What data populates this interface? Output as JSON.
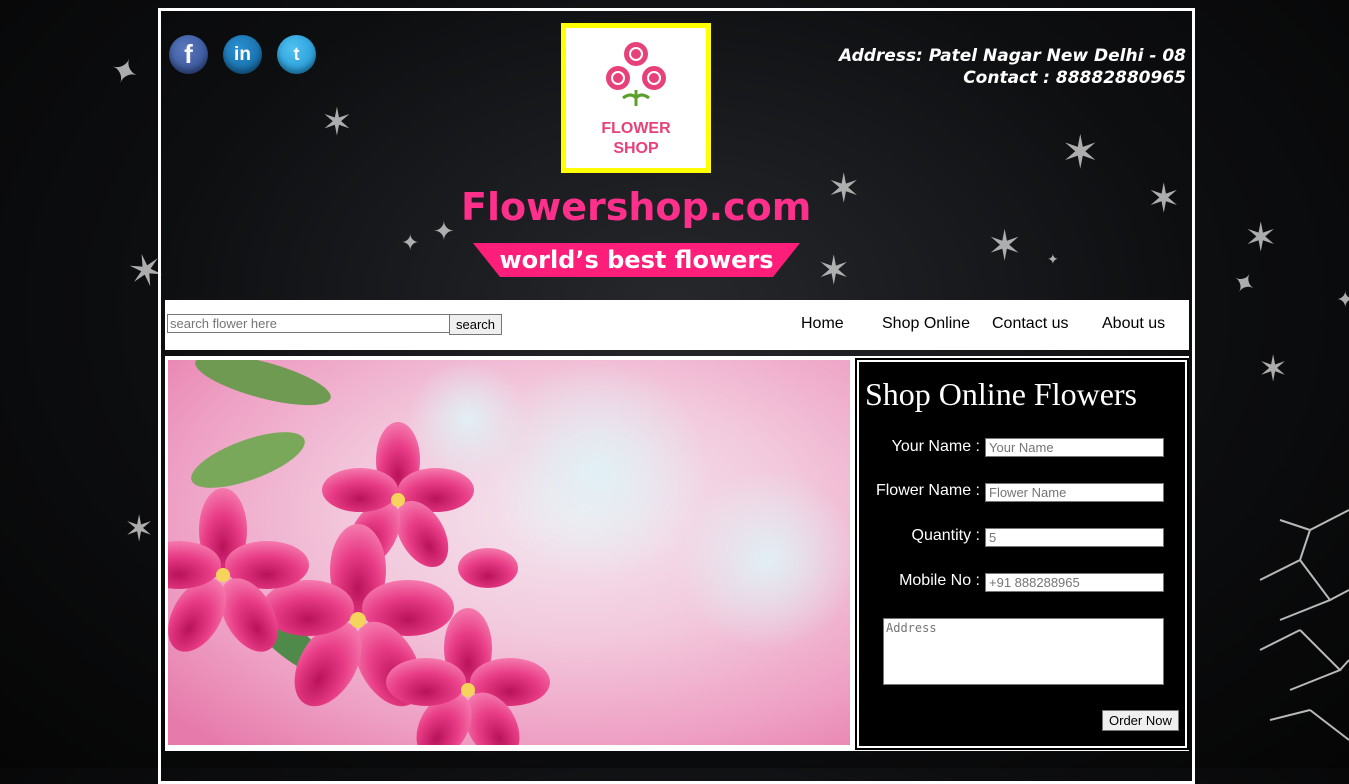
{
  "header": {
    "social": [
      {
        "name": "facebook",
        "glyph": "f"
      },
      {
        "name": "linkedin",
        "glyph": "in"
      },
      {
        "name": "twitter",
        "glyph": "t"
      }
    ],
    "logo": {
      "line1": "FLOWER",
      "line2": "SHOP"
    },
    "site_title": "Flowershop.com",
    "tagline": "world’s best flowers",
    "address": "Address: Patel Nagar New Delhi - 08",
    "contact": "Contact : 88882880965"
  },
  "navbar": {
    "search_placeholder": "search flower here",
    "search_button": "search",
    "links": [
      "Home",
      "Shop Online",
      "Contact us",
      "About us"
    ]
  },
  "order_form": {
    "title": "Shop Online Flowers",
    "fields": [
      {
        "label": "Your Name :",
        "placeholder": "Your Name"
      },
      {
        "label": "Flower Name :",
        "placeholder": "Flower Name"
      },
      {
        "label": "Quantity :",
        "placeholder": "5"
      },
      {
        "label": "Mobile No :",
        "placeholder": "+91 888288965"
      }
    ],
    "address_placeholder": "Address",
    "submit_label": "Order Now"
  },
  "colors": {
    "brand_pink": "#ff2f8c",
    "logo_border": "#ffff00",
    "background": "#0d0e10"
  },
  "icons": [
    "facebook-icon",
    "linkedin-icon",
    "twitter-icon",
    "flower-logo-icon",
    "leaf-icon"
  ]
}
